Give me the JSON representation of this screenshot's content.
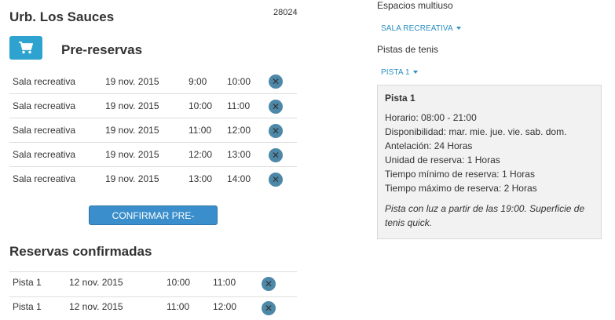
{
  "header": {
    "title": "Urb. Los Sauces",
    "postal_code": "28024"
  },
  "pre_reservas": {
    "heading": "Pre-reservas",
    "cart_icon": "cart-icon",
    "rows": [
      {
        "place": "Sala recreativa",
        "date": "19 nov. 2015",
        "start": "9:00",
        "end": "10:00"
      },
      {
        "place": "Sala recreativa",
        "date": "19 nov. 2015",
        "start": "10:00",
        "end": "11:00"
      },
      {
        "place": "Sala recreativa",
        "date": "19 nov. 2015",
        "start": "11:00",
        "end": "12:00"
      },
      {
        "place": "Sala recreativa",
        "date": "19 nov. 2015",
        "start": "12:00",
        "end": "13:00"
      },
      {
        "place": "Sala recreativa",
        "date": "19 nov. 2015",
        "start": "13:00",
        "end": "14:00"
      }
    ],
    "remove_icon": "close-circle-icon",
    "confirm_label": "CONFIRMAR PRE-RESERVAS"
  },
  "confirmadas": {
    "heading": "Reservas confirmadas",
    "rows": [
      {
        "place": "Pista 1",
        "date": "12 nov. 2015",
        "start": "10:00",
        "end": "11:00"
      },
      {
        "place": "Pista 1",
        "date": "12 nov. 2015",
        "start": "11:00",
        "end": "12:00"
      }
    ]
  },
  "right_panel": {
    "multiuse_label": "Espacios multiuso",
    "multiuse_dropdown": "SALA RECREATIVA",
    "tennis_label": "Pistas de tenis",
    "tennis_dropdown": "PISTA 1",
    "info": {
      "title": "Pista 1",
      "lines": [
        "Horario: 08:00 - 21:00",
        "Disponibilidad: mar. mie. jue. vie. sab. dom.",
        "Antelación: 24 Horas",
        "Unidad de reserva: 1 Horas",
        "Tiempo mínimo de reserva: 1 Horas",
        "Tiempo máximo de reserva: 2 Horas"
      ],
      "note": "Pista con luz a partir de las 19:00. Superficie de tenis quick."
    }
  },
  "colors": {
    "accent": "#2ea3d0",
    "button": "#3a8ecb",
    "remove": "#4d88a8",
    "link": "#2a8fc0"
  }
}
